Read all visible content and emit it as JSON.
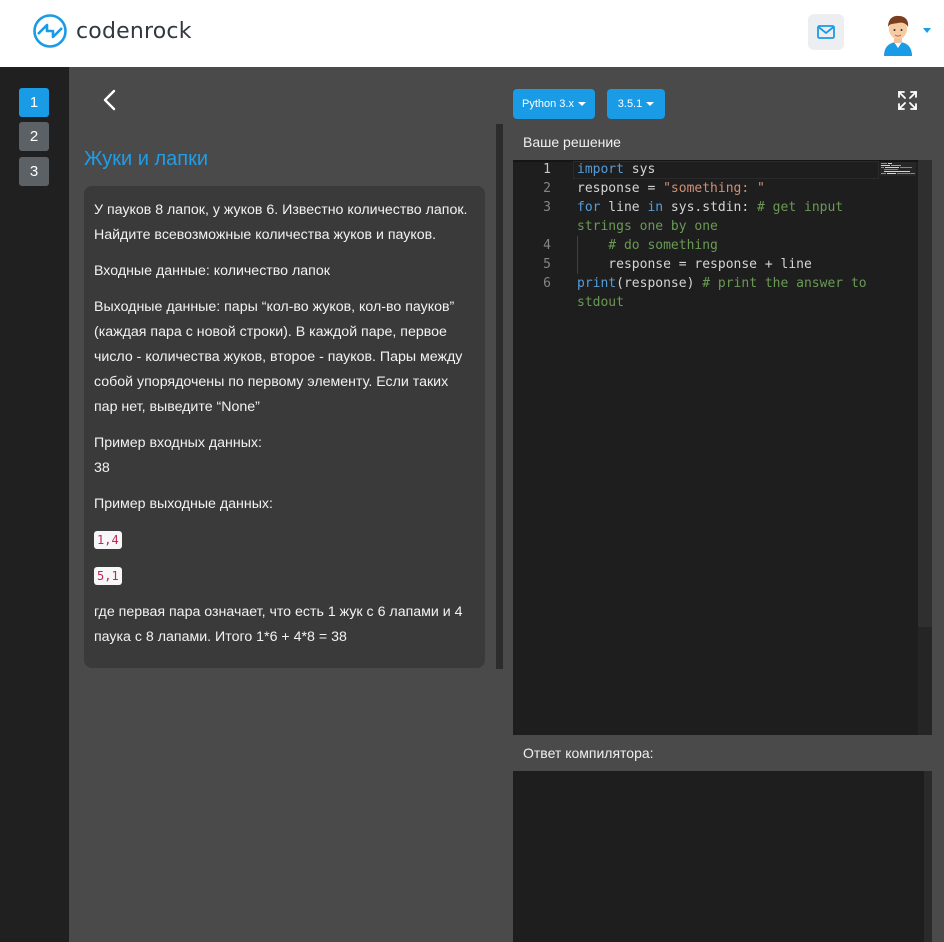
{
  "header": {
    "brand": "codenrock",
    "logo_icon": "codenrock-logo",
    "mail_icon": "mail-icon",
    "avatar_icon": "user-avatar"
  },
  "steps": [
    {
      "label": "1",
      "active": true
    },
    {
      "label": "2",
      "active": false
    },
    {
      "label": "3",
      "active": false
    }
  ],
  "task": {
    "title": "Жуки и лапки",
    "paragraphs": [
      "У пауков 8 лапок, у жуков 6. Известно количество лапок. Найдите всевозможные количества жуков и пауков.",
      "Входные данные: количество лапок",
      "Выходные данные: пары “кол-во жуков, кол-во пауков” (каждая пара с новой строки). В каждой паре, первое число - количества жуков, второе - пауков. Пары между собой упорядочены по первому элементу. Если таких пар нет, выведите  “None”"
    ],
    "example_input_label": "Пример входных данных:",
    "example_input_value": "38",
    "example_output_label": "Пример выходные данных:",
    "example_output_values": [
      "1,4",
      "5,1"
    ],
    "explanation": "где первая пара означает, что есть 1 жук с 6 лапами и 4 паука с 8 лапами. Итого 1*6 + 4*8 = 38"
  },
  "toolbar": {
    "language_label": "Python 3.x",
    "version_label": "3.5.1",
    "fullscreen_icon": "expand-icon"
  },
  "editor": {
    "label": "Ваше решение",
    "line_numbers": [
      "1",
      "2",
      "3",
      "4",
      "5",
      "6"
    ],
    "code": {
      "l1_kw": "import",
      "l1_rest": " sys",
      "l2_rest": "response = ",
      "l2_str": "\"something: \"",
      "l3_kw1": "for",
      "l3_mid1": " line ",
      "l3_kw2": "in",
      "l3_mid2": " sys.stdin: ",
      "l3_cm": "# get input",
      "l3_wrap_cm": "strings one by one",
      "l4_cm": "    # do something",
      "l5_rest": "    response = response + line",
      "l6_fn": "print",
      "l6_rest": "(response) ",
      "l6_cm": "# print the answer to",
      "l6_wrap_cm": "stdout"
    }
  },
  "compiler": {
    "label": "Ответ компилятора:"
  },
  "colors": {
    "accent": "#1a9be6",
    "title": "#1f9ee8",
    "rail": "#202020",
    "panel": "#4a4a4a",
    "card": "#3a3a3a",
    "editor": "#1e1e1e"
  }
}
